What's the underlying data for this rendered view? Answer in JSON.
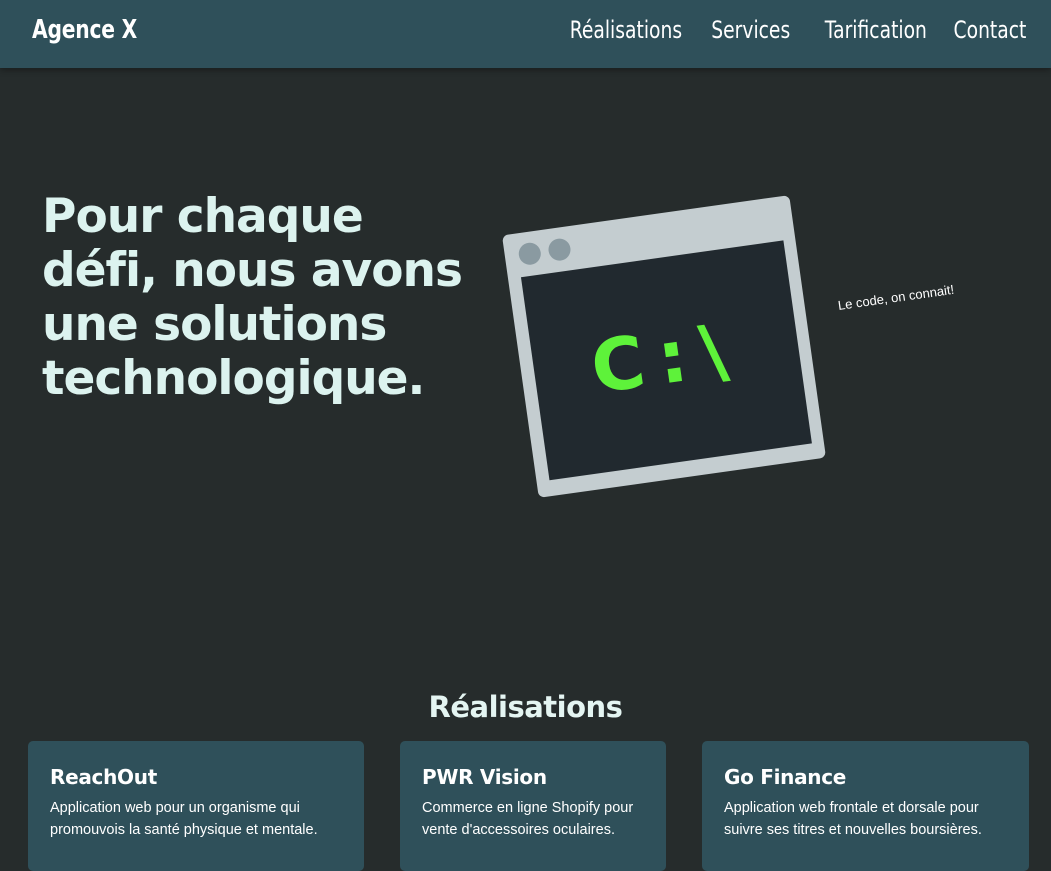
{
  "navbar": {
    "brand": "Agence X",
    "links": [
      "Réalisations",
      "Services",
      "Tarification",
      "Contact"
    ]
  },
  "hero": {
    "title": "Pour chaque défi, nous avons une solutions technologique.",
    "terminal_prompt": "C:\\",
    "tagline": "Le code, on connait!"
  },
  "realisations": {
    "title": "Réalisations",
    "projects": [
      {
        "name": "ReachOut",
        "description": "Application web pour un organisme qui promouvois la santé physique et mentale."
      },
      {
        "name": "PWR Vision",
        "description": "Commerce en ligne Shopify pour vente d'accessoires oculaires."
      },
      {
        "name": "Go Finance",
        "description": "Application web frontale et dorsale pour suivre ses titres et nouvelles boursières."
      }
    ]
  },
  "colors": {
    "navbar_bg": "#2f505a",
    "page_bg": "#262c2c",
    "terminal_green": "#5ef23a",
    "hero_text": "#dcf3ef"
  }
}
